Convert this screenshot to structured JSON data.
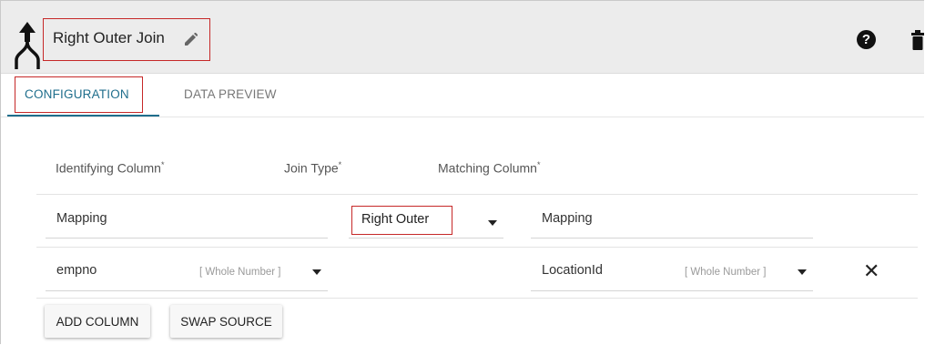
{
  "header": {
    "title": "Right Outer Join",
    "icons": [
      "join-icon",
      "pencil-icon",
      "help-icon",
      "trash-icon"
    ],
    "help_glyph": "?"
  },
  "tabs": [
    {
      "label": "CONFIGURATION",
      "active": true
    },
    {
      "label": "DATA PREVIEW",
      "active": false
    }
  ],
  "columns": {
    "identifying": "Identifying Column",
    "join_type": "Join Type",
    "matching": "Matching Column",
    "required_mark": "*"
  },
  "mapping_row": {
    "left_value": "Mapping",
    "join_type_value": "Right Outer",
    "right_value": "Mapping"
  },
  "column_rows": [
    {
      "left_column": "empno",
      "left_type": "[ Whole Number ]",
      "right_column": "LocationId",
      "right_type": "[ Whole Number ]",
      "remove_glyph": "✕"
    }
  ],
  "buttons": {
    "add_column": "ADD COLUMN",
    "swap_source": "SWAP SOURCE"
  },
  "colors": {
    "accent": "#1f6e8c",
    "highlight": "#c62828",
    "header_bg": "#ececec"
  }
}
